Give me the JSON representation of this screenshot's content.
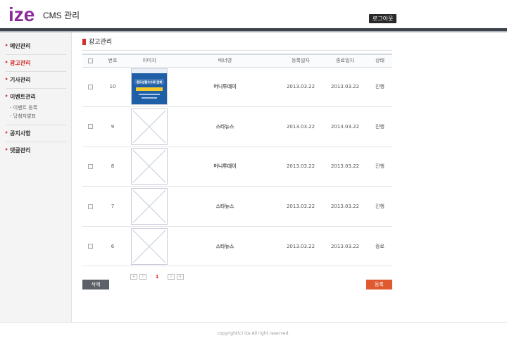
{
  "header": {
    "logo_text": "ize",
    "title": "CMS 관리",
    "logout_label": "로그아웃"
  },
  "sidebar": {
    "items": [
      {
        "label": "메인관리",
        "active": false
      },
      {
        "label": "광고관리",
        "active": true
      },
      {
        "label": "기사관리",
        "active": false
      },
      {
        "label": "이벤트관리",
        "active": false,
        "sub": [
          "- 이벤트 등록",
          "- 당첨자발표"
        ]
      },
      {
        "label": "공지사항",
        "active": false
      },
      {
        "label": "댓글관리",
        "active": false
      }
    ]
  },
  "main": {
    "page_title": "광고관리",
    "columns": [
      "번호",
      "이미지",
      "배너명",
      "등록일자",
      "종료일자",
      "상태"
    ],
    "rows": [
      {
        "num": "10",
        "has_image": true,
        "banner": "머니투데이",
        "reg_date": "2013.03.22",
        "end_date": "2013.03.22",
        "status": "진행"
      },
      {
        "num": "9",
        "has_image": false,
        "banner": "스타뉴스",
        "reg_date": "2013.03.22",
        "end_date": "2013.03.22",
        "status": "진행"
      },
      {
        "num": "8",
        "has_image": false,
        "banner": "머니투데이",
        "reg_date": "2013.03.22",
        "end_date": "2013.03.22",
        "status": "진행"
      },
      {
        "num": "7",
        "has_image": false,
        "banner": "스타뉴스",
        "reg_date": "2013.03.22",
        "end_date": "2013.03.22",
        "status": "진행"
      },
      {
        "num": "6",
        "has_image": false,
        "banner": "스타뉴스",
        "reg_date": "2013.03.22",
        "end_date": "2013.03.22",
        "status": "종료"
      }
    ],
    "ad_image_text": "중도상환수수료 면제"
  },
  "pager": {
    "first": "«",
    "prev": "‹",
    "current": "1",
    "next": "›",
    "last": "»"
  },
  "actions": {
    "delete_label": "삭제",
    "register_label": "등록"
  },
  "footer": {
    "copyright": "copyright(c) ize All right reserved."
  },
  "colors": {
    "accent": "#d0312d",
    "status_on": "#e05a1a",
    "status_off": "#2a5ba8",
    "logo_purple": "#8b2a9a",
    "header_bar": "#3d444c"
  }
}
